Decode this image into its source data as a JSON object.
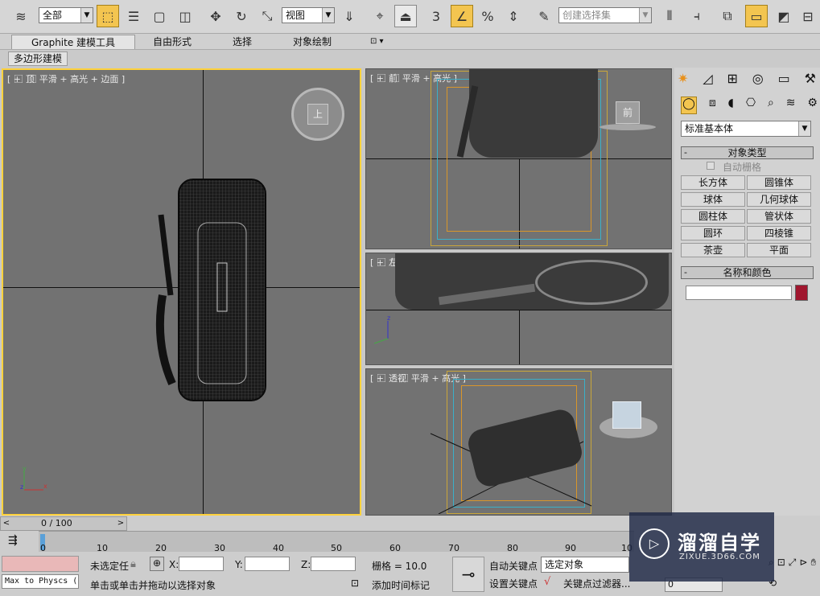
{
  "toolbar": {
    "selection_filter": "全部",
    "reference_coord": "视图",
    "snap_label": "3",
    "selection_set_placeholder": "创建选择集"
  },
  "ribbon": {
    "tabs": [
      "Graphite 建模工具",
      "自由形式",
      "选择",
      "对象绘制"
    ],
    "sub_label": "多边形建模"
  },
  "viewports": {
    "top": "[ + ⃞ 顶 ⃞ 平滑 + 高光 + 边面 ]",
    "front": "[ + ⃞ 前 ⃞ 平滑 + 高光 ]",
    "left": "[ + ⃞ 左 ⃞ 平滑 + 高光 ]",
    "persp": "[ + ⃞ 透视 ⃞ 平滑 + 高光 ]",
    "top_cube_label": "上",
    "front_cube_label": "前"
  },
  "command_panel": {
    "dropdown": "标准基本体",
    "object_type_title": "对象类型",
    "auto_grid": "自动栅格",
    "buttons": [
      "长方体",
      "圆锥体",
      "球体",
      "几何球体",
      "圆柱体",
      "管状体",
      "圆环",
      "四棱锥",
      "茶壶",
      "平面"
    ],
    "name_color_title": "名称和颜色",
    "name_value": "",
    "color": "#a0162e"
  },
  "timeline": {
    "frame_display": "0 / 100",
    "ticks": [
      "0",
      "10",
      "20",
      "30",
      "40",
      "50",
      "60",
      "70",
      "80",
      "90",
      "10"
    ]
  },
  "status": {
    "maxscript": "Max to Physcs (",
    "selection_status": "未选定任",
    "x_label": "X:",
    "y_label": "Y:",
    "z_label": "Z:",
    "grid": "栅格 = 10.0",
    "prompt": "单击或单击并拖动以选择对象",
    "add_time_tag": "添加时间标记",
    "auto_key": "自动关键点",
    "set_key": "设置关键点",
    "key_mode": "选定对象",
    "key_filter": "关键点过滤器...",
    "frame": "0"
  },
  "watermark": {
    "title": "溜溜自学",
    "url": "ZIXUE.3D66.COM"
  }
}
